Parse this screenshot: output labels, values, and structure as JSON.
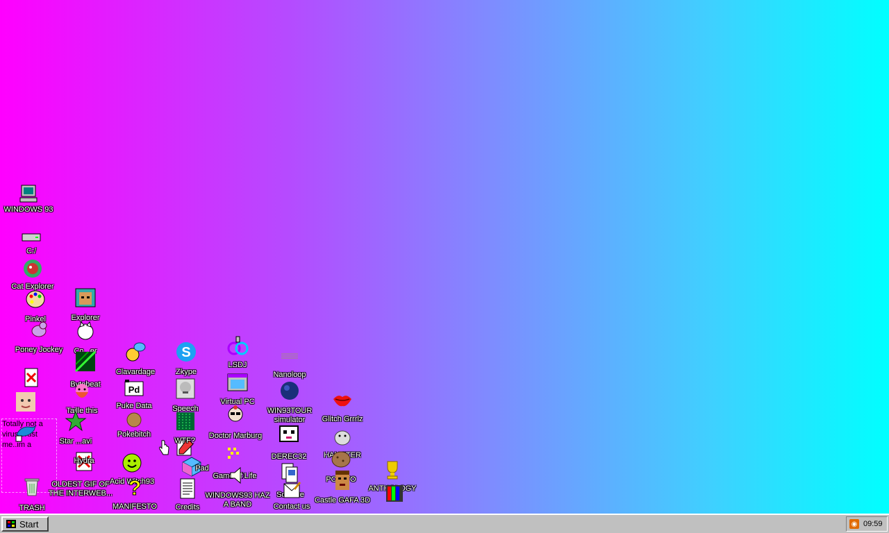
{
  "desktop": {
    "icons": {
      "windows93": "WINDOWS 93",
      "c_drive": "C:/",
      "cat_explorer": "Cat Explorer",
      "pinkel": "Pinkel",
      "explorer": "Explorer",
      "poney_jockey": "Poney Jockey",
      "cat_guru": "Co...er",
      "byte_beat": "Bytebeat",
      "clavardage": "Clavardage",
      "zkype": "Zkype",
      "lsdj": "LSDJ",
      "nanoloop": "Nanoloop",
      "puke_data": "Puke Data",
      "speech": "Speech",
      "virtual_pc": "Virtual PC",
      "win93tour": "WIN93TOUR simulator",
      "glitch_grrrlz": "Glitch Grrrlz",
      "taille_this": "Taille this",
      "star_wave": "Star ...avi",
      "poke_bitch": "Pokebitch",
      "wtf": "WTF?",
      "doctor_marburg": "Doctor Marburg",
      "derec32": "DEREC32",
      "hamster": "HAMSTER",
      "hydra": "Hydra",
      "acid_witch": "Acid Witch93",
      "pad": "Pad",
      "game_of_life": "Game of Life",
      "solitaire": "Solitaire",
      "potato": "POTATO",
      "castle_gafa": "Castle GAFA 3D",
      "anthology": "ANTHOLOGY",
      "oldest_gif": "OLDEST GIF OF THE INTERWEB...",
      "manifesto": "MANIFESTO",
      "credits": "Credits",
      "windows93_band": "WINDOWS93 HAZ A BAND",
      "contact_us": "Contact us",
      "trash": "TRASH",
      "virus": "Totally not a virus.Trust me..im a"
    }
  },
  "taskbar": {
    "start_label": "Start",
    "clock": "09:59"
  }
}
